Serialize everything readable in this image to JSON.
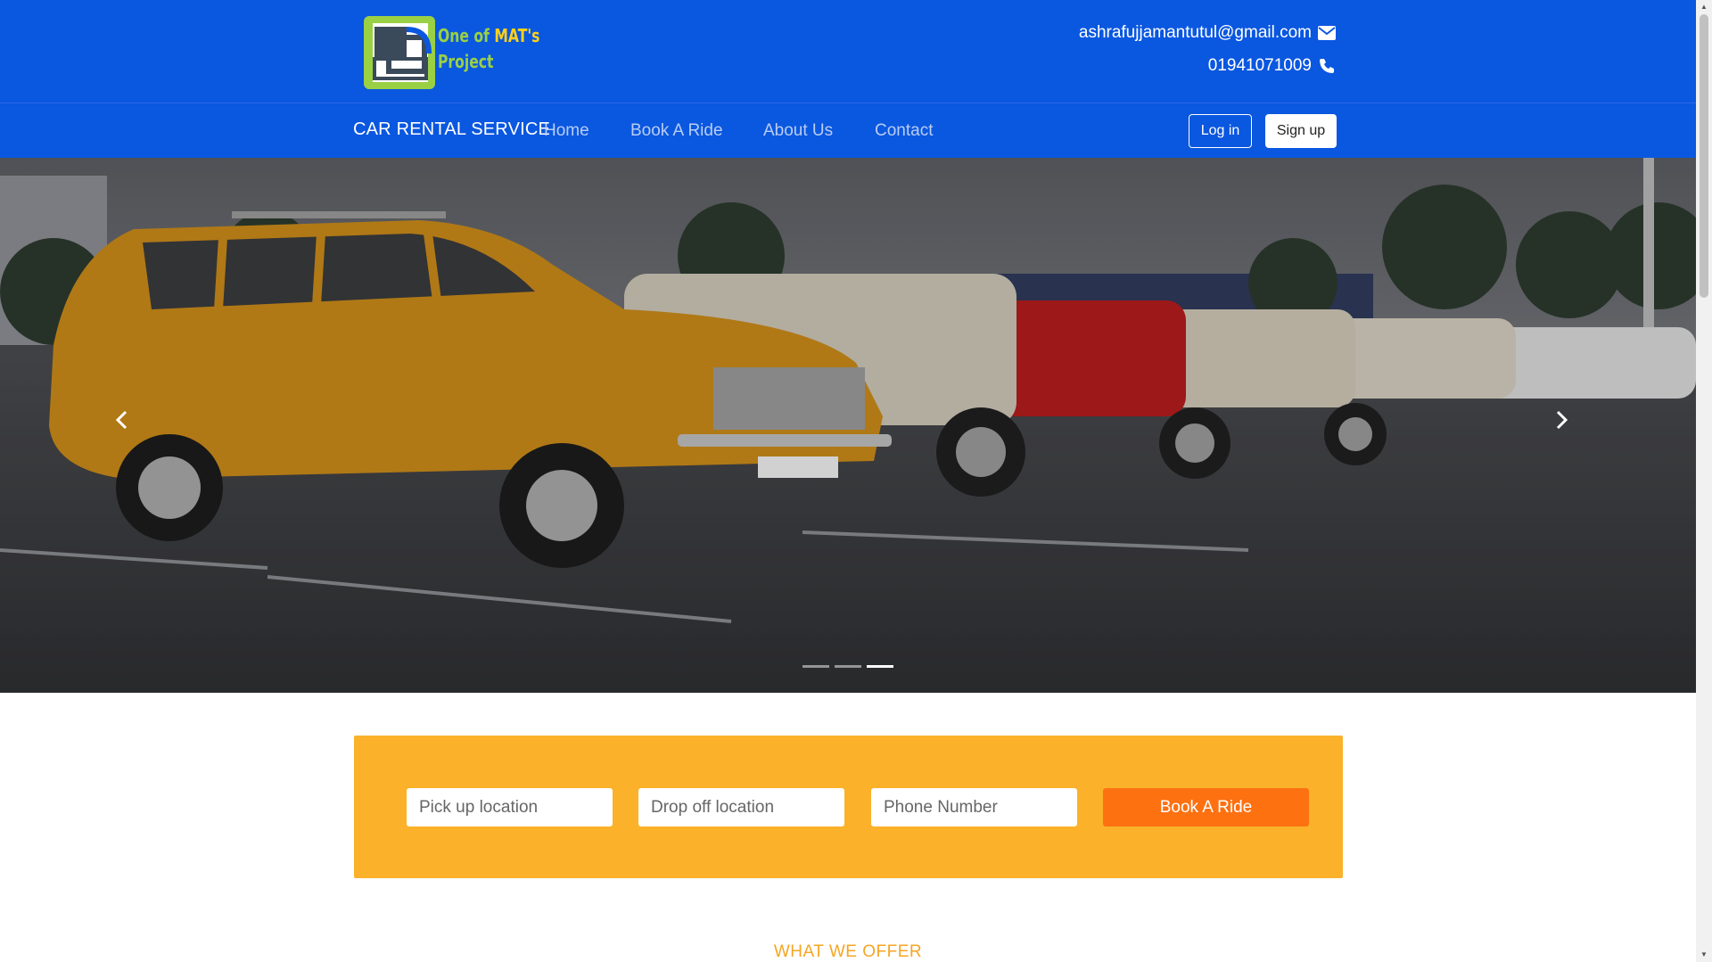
{
  "header": {
    "logo_line1": "One of ",
    "logo_line1_highlight": "MAT's",
    "logo_line2": "Project",
    "email": "ashrafujjamantutul@gmail.com",
    "phone": "01941071009",
    "email_icon": "envelope-icon",
    "phone_icon": "phone-icon"
  },
  "navbar": {
    "brand": "CAR RENTAL SERVICE",
    "links": [
      "Home",
      "Book A Ride",
      "About Us",
      "Contact"
    ],
    "login_label": "Log in",
    "signup_label": "Sign up"
  },
  "carousel": {
    "prev_icon": "chevron-left-icon",
    "next_icon": "chevron-right-icon",
    "slide_count": 3,
    "active_index": 2
  },
  "booking": {
    "pickup_placeholder": "Pick up location",
    "dropoff_placeholder": "Drop off location",
    "phone_placeholder": "Phone Number",
    "book_label": "Book A Ride"
  },
  "section": {
    "offer_title": "WHAT WE OFFER"
  },
  "colors": {
    "primary": "#0a57e0",
    "booking_bg": "#fbb12a",
    "book_button": "#fd7111",
    "offer_title": "#f5a623"
  }
}
